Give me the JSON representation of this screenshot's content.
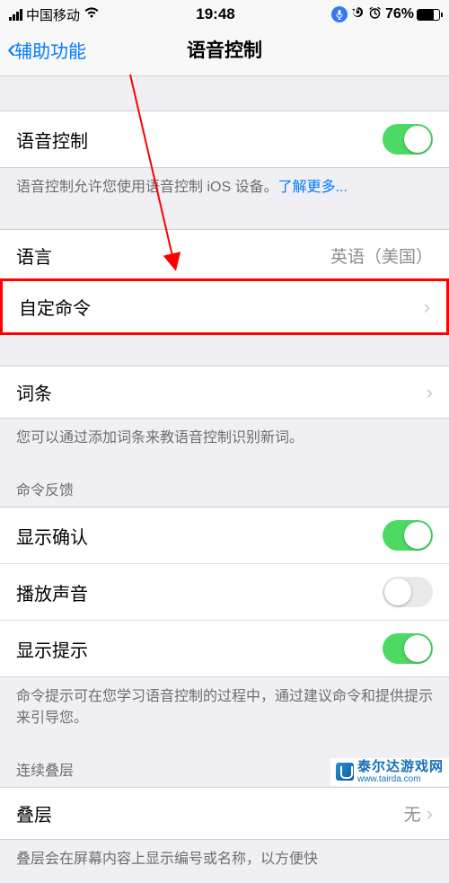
{
  "statusBar": {
    "carrier": "中国移动",
    "time": "19:48",
    "batteryPercent": "76%",
    "batteryFill": 76
  },
  "nav": {
    "back": "辅助功能",
    "title": "语音控制"
  },
  "voiceControl": {
    "label": "语音控制",
    "on": true,
    "footer": "语音控制允许您使用语音控制 iOS 设备。",
    "learnMore": "了解更多..."
  },
  "language": {
    "label": "语言",
    "value": "英语（美国）"
  },
  "customCommands": {
    "label": "自定命令"
  },
  "vocabulary": {
    "label": "词条",
    "footer": "您可以通过添加词条来教语音控制识别新词。"
  },
  "feedback": {
    "header": "命令反馈",
    "showConfirm": "显示确认",
    "playSound": "播放声音",
    "showHints": "显示提示",
    "footer": "命令提示可在您学习语音控制的过程中，通过建议命令和提供提示来引导您。"
  },
  "overlay": {
    "header": "连续叠层",
    "label": "叠层",
    "value": "无",
    "footer": "叠层会在屏幕内容上显示编号或名称，以方便快"
  },
  "watermark": {
    "name": "泰尔达游戏网",
    "url": "www.tairda.com"
  }
}
